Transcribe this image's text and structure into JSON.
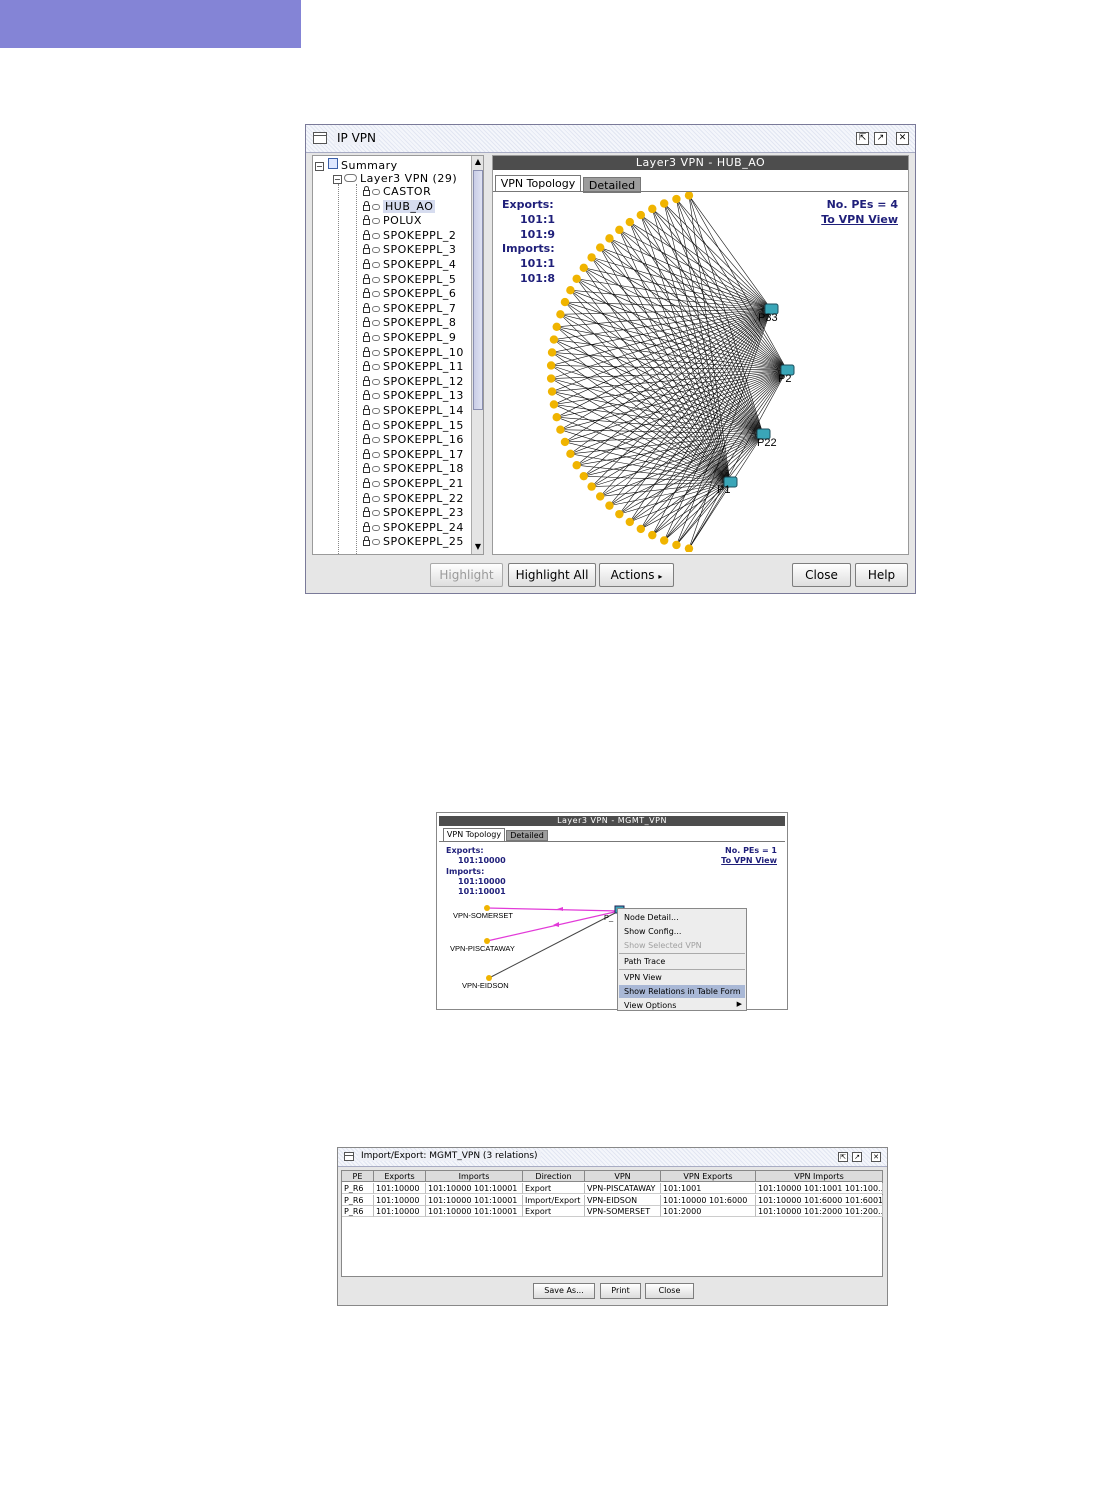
{
  "window1": {
    "title": "IP VPN",
    "tree": {
      "root": "Summary",
      "group": "Layer3 VPN (29)",
      "items": [
        "CASTOR",
        "HUB_AO",
        "POLUX",
        "SPOKEPPL_2",
        "SPOKEPPL_3",
        "SPOKEPPL_4",
        "SPOKEPPL_5",
        "SPOKEPPL_6",
        "SPOKEPPL_7",
        "SPOKEPPL_8",
        "SPOKEPPL_9",
        "SPOKEPPL_10",
        "SPOKEPPL_11",
        "SPOKEPPL_12",
        "SPOKEPPL_13",
        "SPOKEPPL_14",
        "SPOKEPPL_15",
        "SPOKEPPL_16",
        "SPOKEPPL_17",
        "SPOKEPPL_18",
        "SPOKEPPL_21",
        "SPOKEPPL_22",
        "SPOKEPPL_23",
        "SPOKEPPL_24",
        "SPOKEPPL_25"
      ],
      "selected": "HUB_AO"
    },
    "panel_header": "Layer3 VPN - HUB_AO",
    "tabs": [
      "VPN Topology",
      "Detailed"
    ],
    "exports_label": "Exports:",
    "exports": [
      "101:1",
      "101:9"
    ],
    "imports_label": "Imports:",
    "imports": [
      "101:1",
      "101:8"
    ],
    "pe_count": "No. PEs = 4",
    "vpn_view_link": "To VPN View",
    "pe_nodes": [
      "P33",
      "P2",
      "P22",
      "P1"
    ],
    "spoke_node_count": 38,
    "buttons": {
      "highlight": "Highlight",
      "highlight_all": "Highlight All",
      "actions": "Actions",
      "close": "Close",
      "help": "Help"
    }
  },
  "window2": {
    "panel_header": "Layer3 VPN - MGMT_VPN",
    "tabs": [
      "VPN Topology",
      "Detailed"
    ],
    "exports_label": "Exports:",
    "exports": [
      "101:10000"
    ],
    "imports_label": "Imports:",
    "imports": [
      "101:10000",
      "101:10001"
    ],
    "pe_count": "No. PEs = 1",
    "vpn_view_link": "To VPN View",
    "nodes": [
      "VPN-SOMERSET",
      "VPN-PISCATAWAY",
      "VPN-EIDSON"
    ],
    "pe_label": "P_",
    "menu": {
      "items": [
        "Node Detail...",
        "Show Config...",
        "Show Selected VPN",
        "Path Trace",
        "VPN View",
        "Show Relations in Table Form",
        "View Options"
      ],
      "disabled": "Show Selected VPN",
      "highlighted": "Show Relations in Table Form"
    },
    "colors": {
      "link_pink": "#e23ad8",
      "link_dark": "#444444",
      "node_yellow": "#f0b400"
    }
  },
  "window3": {
    "title": "Import/Export: MGMT_VPN (3 relations)",
    "columns": [
      "PE",
      "Exports",
      "Imports",
      "Direction",
      "VPN",
      "VPN Exports",
      "VPN Imports"
    ],
    "rows": [
      [
        "P_R6",
        "101:10000",
        "101:10000 101:10001",
        "Export",
        "VPN-PISCATAWAY",
        "101:1001",
        "101:10000 101:1001 101:100..."
      ],
      [
        "P_R6",
        "101:10000",
        "101:10000 101:10001",
        "Import/Export",
        "VPN-EIDSON",
        "101:10000 101:6000",
        "101:10000 101:6000 101:6001"
      ],
      [
        "P_R6",
        "101:10000",
        "101:10000 101:10001",
        "Export",
        "VPN-SOMERSET",
        "101:2000",
        "101:10000 101:2000 101:200..."
      ]
    ],
    "buttons": {
      "save_as": "Save As...",
      "print": "Print",
      "close": "Close"
    }
  },
  "colors": {
    "accent_bar": "#8484d6",
    "link_blue": "#1f1f7a",
    "header_dark": "#4d4d4d",
    "node_yellow": "#f0b400",
    "router_teal": "#3aa6b8"
  }
}
